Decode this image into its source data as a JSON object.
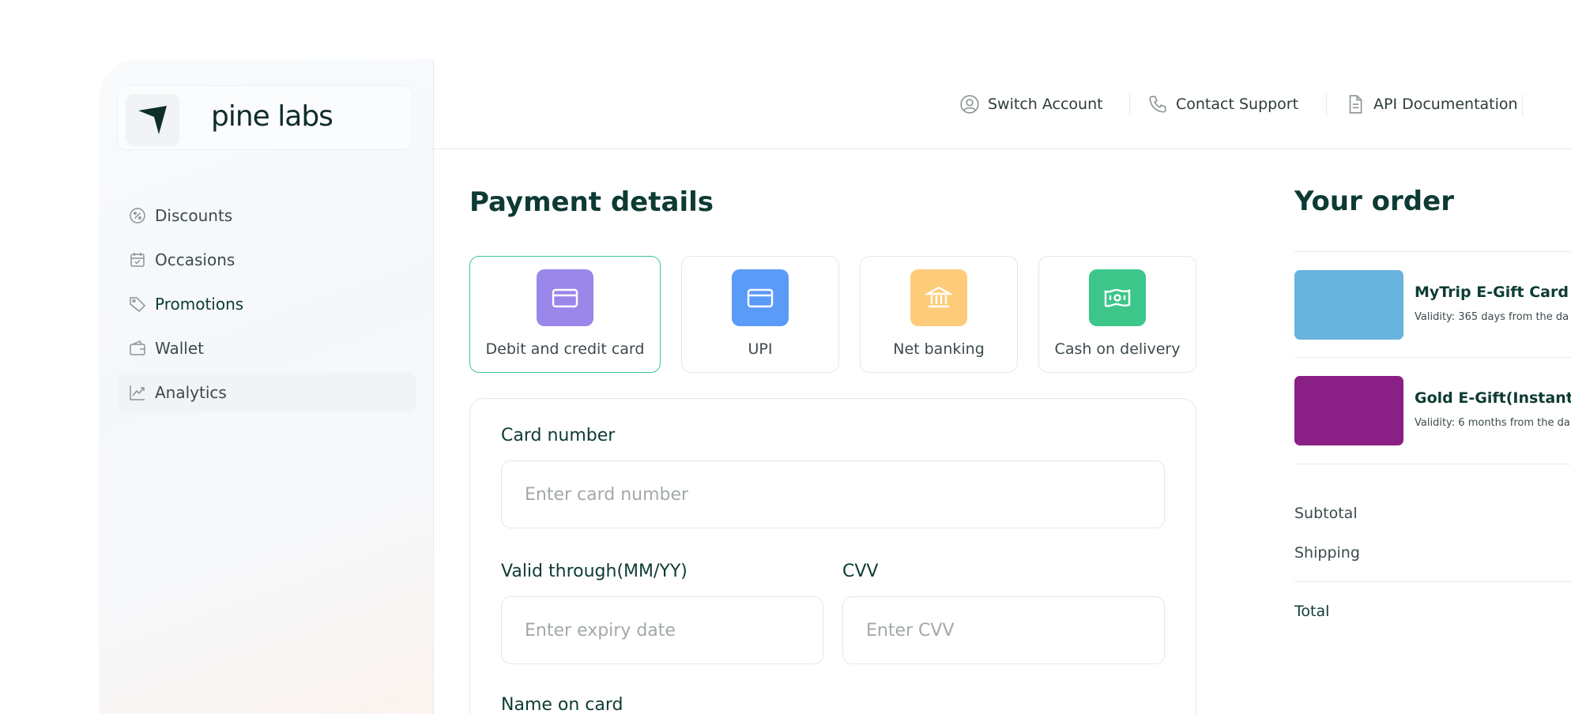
{
  "brand": {
    "name": "pine labs"
  },
  "sidebar": {
    "items": [
      {
        "label": "Discounts",
        "icon": "discount-icon"
      },
      {
        "label": "Occasions",
        "icon": "calendar-icon"
      },
      {
        "label": "Promotions",
        "icon": "tag-icon"
      },
      {
        "label": "Wallet",
        "icon": "wallet-icon"
      },
      {
        "label": "Analytics",
        "icon": "analytics-icon"
      }
    ],
    "active_item": "Analytics"
  },
  "topbar": {
    "items": [
      {
        "label": "Switch Account",
        "icon": "user-circle-icon"
      },
      {
        "label": "Contact Support",
        "icon": "phone-icon"
      },
      {
        "label": "API Documentation",
        "icon": "document-icon"
      }
    ]
  },
  "payment": {
    "title": "Payment details",
    "methods": [
      {
        "label": "Debit and credit card",
        "icon": "credit-card-icon",
        "color": "#9b86ea",
        "selected": true
      },
      {
        "label": "UPI",
        "icon": "credit-card-icon",
        "color": "#5b9bf8",
        "selected": false
      },
      {
        "label": "Net banking",
        "icon": "bank-icon",
        "color": "#fdcb7a",
        "selected": false
      },
      {
        "label": "Cash on delivery",
        "icon": "cash-icon",
        "color": "#3cc68a",
        "selected": false
      }
    ],
    "form": {
      "card_number": {
        "label": "Card number",
        "placeholder": "Enter card number"
      },
      "expiry": {
        "label": "Valid through(MM/YY)",
        "placeholder": "Enter expiry date"
      },
      "cvv": {
        "label": "CVV",
        "placeholder": "Enter CVV"
      },
      "name": {
        "label": "Name on card"
      }
    }
  },
  "order": {
    "title": "Your order",
    "items": [
      {
        "name": "MyTrip E-Gift Card",
        "validity": "Validity: 365 days from the da",
        "color": "#68b3dd"
      },
      {
        "name": "Gold E-Gift(Instant V",
        "validity": "Validity: 6 months from the da",
        "color": "#8a1f86"
      }
    ],
    "summary": {
      "subtotal": "Subtotal",
      "shipping": "Shipping",
      "total": "Total"
    }
  },
  "colors": {
    "accent": "#3ec594",
    "brand_dark": "#0d3b34"
  }
}
